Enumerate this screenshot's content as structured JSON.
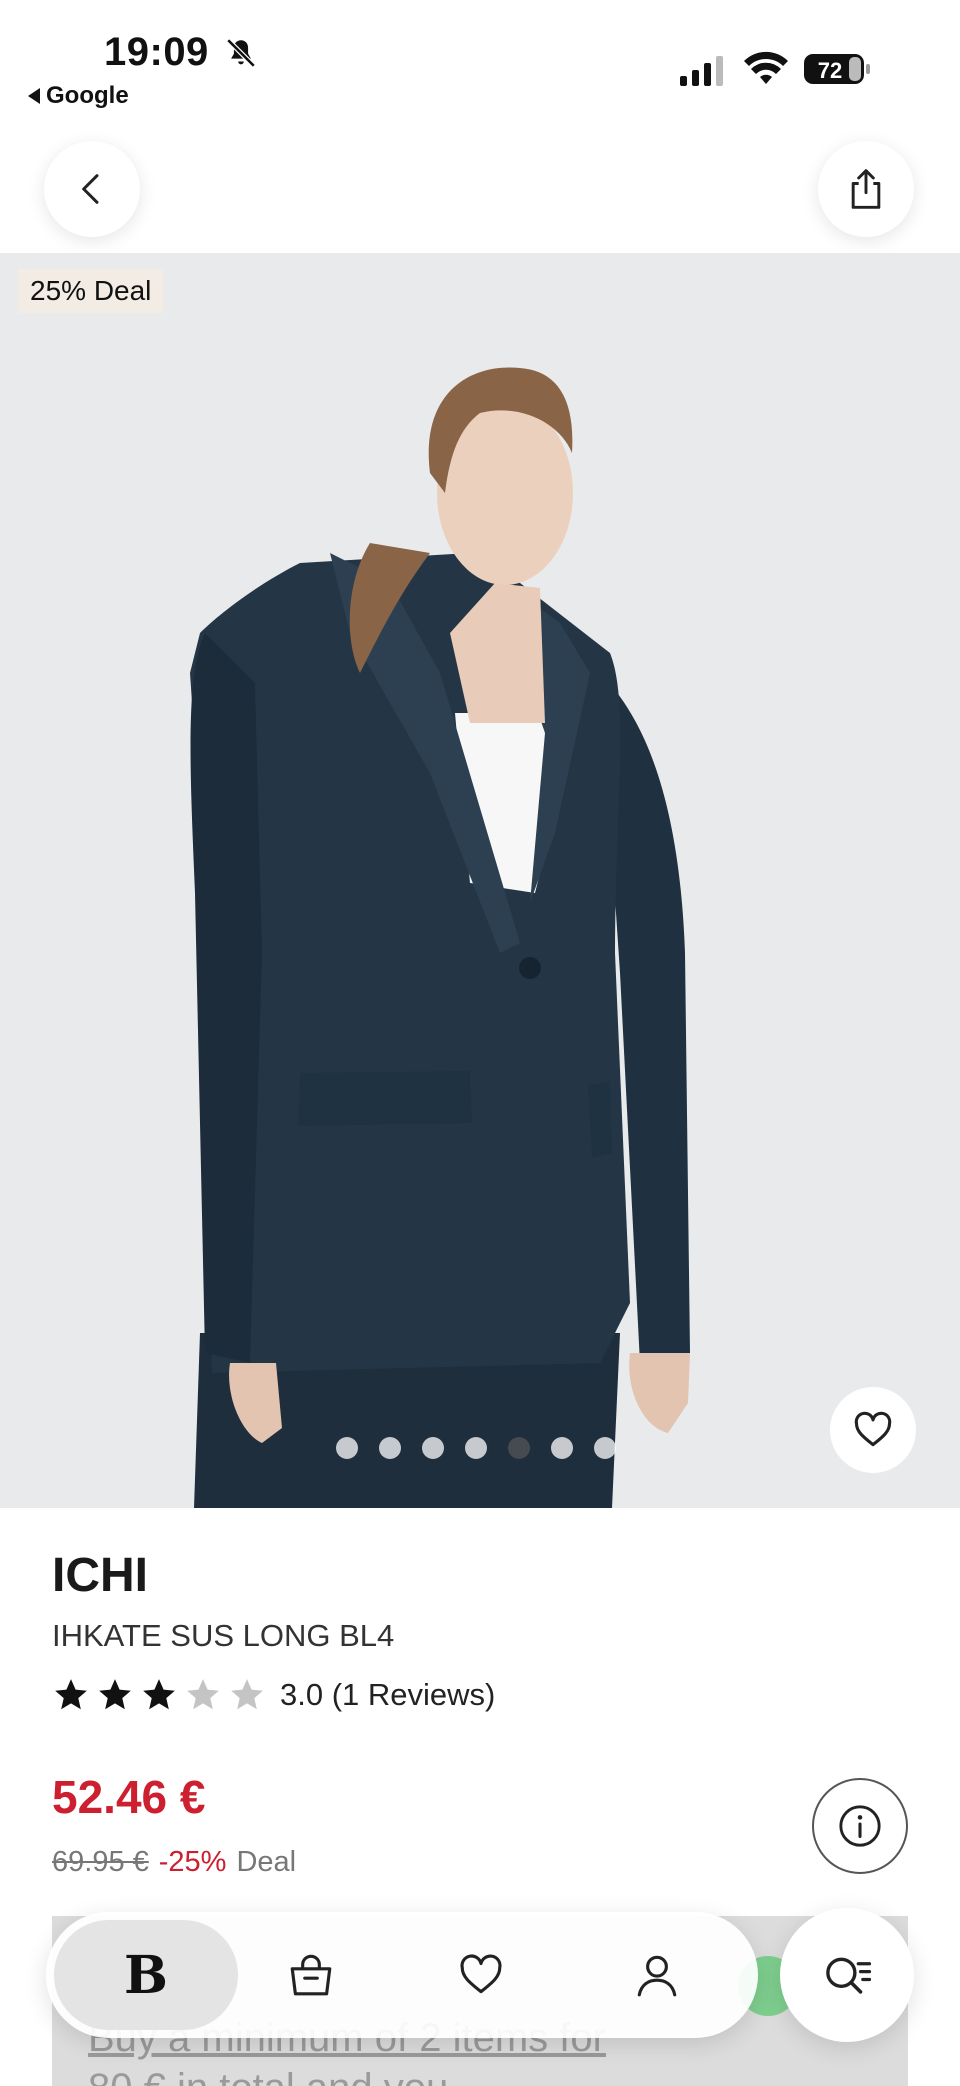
{
  "status_bar": {
    "time": "19:09",
    "back_app": "Google",
    "battery": "72"
  },
  "hero": {
    "deal_badge": "25% Deal",
    "image_count": 7,
    "active_image": 5
  },
  "product": {
    "brand": "ICHI",
    "name": "IHKATE SUS LONG BL4",
    "rating_value": 3,
    "rating_max": 5,
    "rating_text": "3.0 (1 Reviews)",
    "price": "52.46 €",
    "old_price": "69.95 €",
    "discount": "-25%",
    "deal_label": "Deal"
  },
  "promo": {
    "line1": "Buy a minimum of 2 items for",
    "line2": "80 € in total and you"
  },
  "tabbar": {
    "home_logo": "B"
  },
  "colors": {
    "price_red": "#cc1f2f",
    "badge_bg": "#f3ece4",
    "jacket": "#243646",
    "hero_bg": "#e9eaec"
  },
  "icons": [
    "bell-slash-icon",
    "chevron-left-icon",
    "share-icon",
    "heart-icon",
    "info-icon",
    "shopping-bag-icon",
    "user-icon",
    "search-list-icon",
    "star-icon"
  ]
}
